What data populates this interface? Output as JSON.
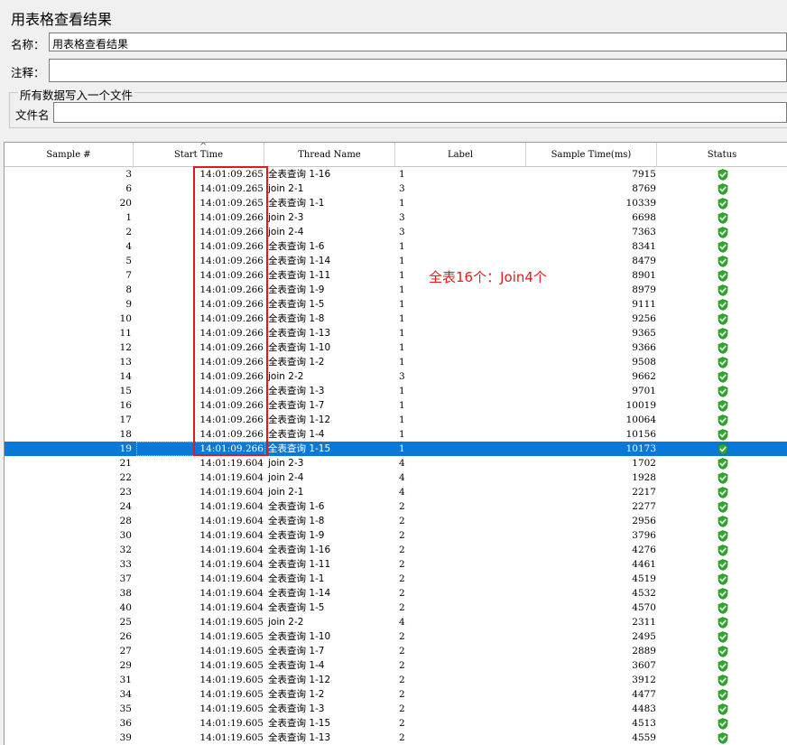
{
  "panel": {
    "title": "用表格查看结果",
    "name_label": "名称：",
    "name_value": "用表格查看结果",
    "comment_label": "注释：",
    "comment_value": "",
    "group_title": "所有数据写入一个文件",
    "file_label": "文件名",
    "file_value": ""
  },
  "table": {
    "columns": [
      "Sample #",
      "Start Time",
      "Thread Name",
      "Label",
      "Sample Time(ms)",
      "Status"
    ],
    "sorted_column": "Start Time",
    "selected_row": 19,
    "status_icon": "shield-check-icon",
    "status_color": "#2fa82f",
    "rows": [
      {
        "num": "3",
        "time": "14:01:09.265",
        "thread": "全表查询 1-16",
        "label": "1",
        "st": "7915"
      },
      {
        "num": "6",
        "time": "14:01:09.265",
        "thread": "join 2-1",
        "label": "3",
        "st": "8769"
      },
      {
        "num": "20",
        "time": "14:01:09.265",
        "thread": "全表查询 1-1",
        "label": "1",
        "st": "10339"
      },
      {
        "num": "1",
        "time": "14:01:09.266",
        "thread": "join 2-3",
        "label": "3",
        "st": "6698"
      },
      {
        "num": "2",
        "time": "14:01:09.266",
        "thread": "join 2-4",
        "label": "3",
        "st": "7363"
      },
      {
        "num": "4",
        "time": "14:01:09.266",
        "thread": "全表查询 1-6",
        "label": "1",
        "st": "8341"
      },
      {
        "num": "5",
        "time": "14:01:09.266",
        "thread": "全表查询 1-14",
        "label": "1",
        "st": "8479"
      },
      {
        "num": "7",
        "time": "14:01:09.266",
        "thread": "全表查询 1-11",
        "label": "1",
        "st": "8901"
      },
      {
        "num": "8",
        "time": "14:01:09.266",
        "thread": "全表查询 1-9",
        "label": "1",
        "st": "8979"
      },
      {
        "num": "9",
        "time": "14:01:09.266",
        "thread": "全表查询 1-5",
        "label": "1",
        "st": "9111"
      },
      {
        "num": "10",
        "time": "14:01:09.266",
        "thread": "全表查询 1-8",
        "label": "1",
        "st": "9256"
      },
      {
        "num": "11",
        "time": "14:01:09.266",
        "thread": "全表查询 1-13",
        "label": "1",
        "st": "9365"
      },
      {
        "num": "12",
        "time": "14:01:09.266",
        "thread": "全表查询 1-10",
        "label": "1",
        "st": "9366"
      },
      {
        "num": "13",
        "time": "14:01:09.266",
        "thread": "全表查询 1-2",
        "label": "1",
        "st": "9508"
      },
      {
        "num": "14",
        "time": "14:01:09.266",
        "thread": "join 2-2",
        "label": "3",
        "st": "9662"
      },
      {
        "num": "15",
        "time": "14:01:09.266",
        "thread": "全表查询 1-3",
        "label": "1",
        "st": "9701"
      },
      {
        "num": "16",
        "time": "14:01:09.266",
        "thread": "全表查询 1-7",
        "label": "1",
        "st": "10019"
      },
      {
        "num": "17",
        "time": "14:01:09.266",
        "thread": "全表查询 1-12",
        "label": "1",
        "st": "10064"
      },
      {
        "num": "18",
        "time": "14:01:09.266",
        "thread": "全表查询 1-4",
        "label": "1",
        "st": "10156"
      },
      {
        "num": "19",
        "time": "14:01:09.266",
        "thread": "全表查询 1-15",
        "label": "1",
        "st": "10173"
      },
      {
        "num": "21",
        "time": "14:01:19.604",
        "thread": "join 2-3",
        "label": "4",
        "st": "1702"
      },
      {
        "num": "22",
        "time": "14:01:19.604",
        "thread": "join 2-4",
        "label": "4",
        "st": "1928"
      },
      {
        "num": "23",
        "time": "14:01:19.604",
        "thread": "join 2-1",
        "label": "4",
        "st": "2217"
      },
      {
        "num": "24",
        "time": "14:01:19.604",
        "thread": "全表查询 1-6",
        "label": "2",
        "st": "2277"
      },
      {
        "num": "28",
        "time": "14:01:19.604",
        "thread": "全表查询 1-8",
        "label": "2",
        "st": "2956"
      },
      {
        "num": "30",
        "time": "14:01:19.604",
        "thread": "全表查询 1-9",
        "label": "2",
        "st": "3796"
      },
      {
        "num": "32",
        "time": "14:01:19.604",
        "thread": "全表查询 1-16",
        "label": "2",
        "st": "4276"
      },
      {
        "num": "33",
        "time": "14:01:19.604",
        "thread": "全表查询 1-11",
        "label": "2",
        "st": "4461"
      },
      {
        "num": "37",
        "time": "14:01:19.604",
        "thread": "全表查询 1-1",
        "label": "2",
        "st": "4519"
      },
      {
        "num": "38",
        "time": "14:01:19.604",
        "thread": "全表查询 1-14",
        "label": "2",
        "st": "4532"
      },
      {
        "num": "40",
        "time": "14:01:19.604",
        "thread": "全表查询 1-5",
        "label": "2",
        "st": "4570"
      },
      {
        "num": "25",
        "time": "14:01:19.605",
        "thread": "join 2-2",
        "label": "4",
        "st": "2311"
      },
      {
        "num": "26",
        "time": "14:01:19.605",
        "thread": "全表查询 1-10",
        "label": "2",
        "st": "2495"
      },
      {
        "num": "27",
        "time": "14:01:19.605",
        "thread": "全表查询 1-7",
        "label": "2",
        "st": "2889"
      },
      {
        "num": "29",
        "time": "14:01:19.605",
        "thread": "全表查询 1-4",
        "label": "2",
        "st": "3607"
      },
      {
        "num": "31",
        "time": "14:01:19.605",
        "thread": "全表查询 1-12",
        "label": "2",
        "st": "3912"
      },
      {
        "num": "34",
        "time": "14:01:19.605",
        "thread": "全表查询 1-2",
        "label": "2",
        "st": "4477"
      },
      {
        "num": "35",
        "time": "14:01:19.605",
        "thread": "全表查询 1-3",
        "label": "2",
        "st": "4483"
      },
      {
        "num": "36",
        "time": "14:01:19.605",
        "thread": "全表查询 1-15",
        "label": "2",
        "st": "4513"
      },
      {
        "num": "39",
        "time": "14:01:19.605",
        "thread": "全表查询 1-13",
        "label": "2",
        "st": "4559"
      }
    ]
  },
  "annotation": {
    "text": "全表16个：Join4个",
    "color": "#e31b1b",
    "box_color": "#e01919"
  }
}
